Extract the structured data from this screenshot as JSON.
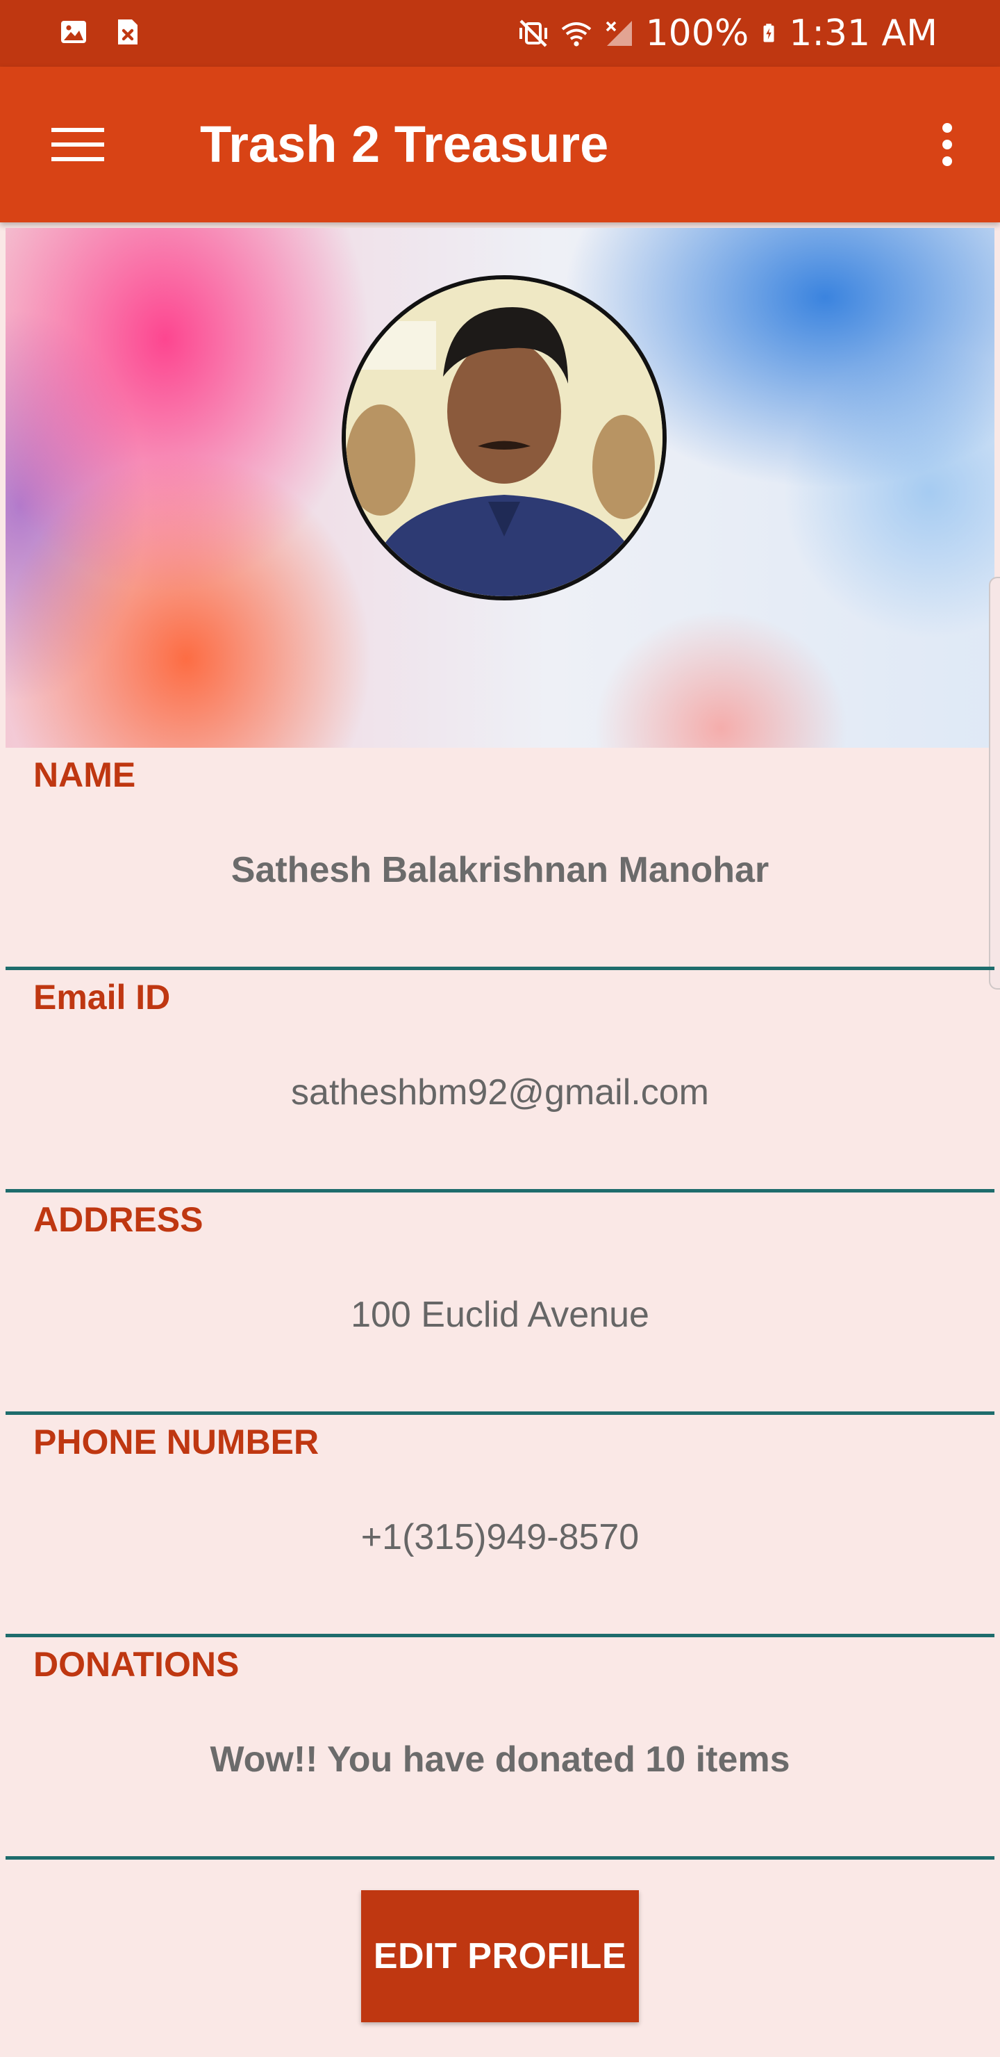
{
  "status_bar": {
    "battery": "100%",
    "time": "1:31 AM",
    "icons": [
      "gallery-icon",
      "close-box-icon",
      "mute-vibrate-icon",
      "wifi-icon",
      "no-signal-icon",
      "battery-charging-icon"
    ]
  },
  "app_bar": {
    "title": "Trash 2 Treasure",
    "icons": [
      "hamburger-menu-icon",
      "more-vertical-icon"
    ]
  },
  "profile": {
    "fields": [
      {
        "label": "NAME",
        "value": "Sathesh Balakrishnan Manohar"
      },
      {
        "label": "Email ID",
        "value": "satheshbm92@gmail.com"
      },
      {
        "label": "ADDRESS",
        "value": "100 Euclid Avenue"
      },
      {
        "label": "PHONE NUMBER",
        "value": "+1(315)949-8570"
      },
      {
        "label": "DONATIONS",
        "value": "Wow!! You have donated 10 items"
      }
    ],
    "edit_button": "EDIT PROFILE"
  },
  "colors": {
    "status_bar": "#BF3711",
    "app_bar": "#D84315",
    "page_background": "#FAE8E6",
    "label": "#BF3711",
    "divider": "#1E6C6C",
    "button": "#BF3711"
  }
}
